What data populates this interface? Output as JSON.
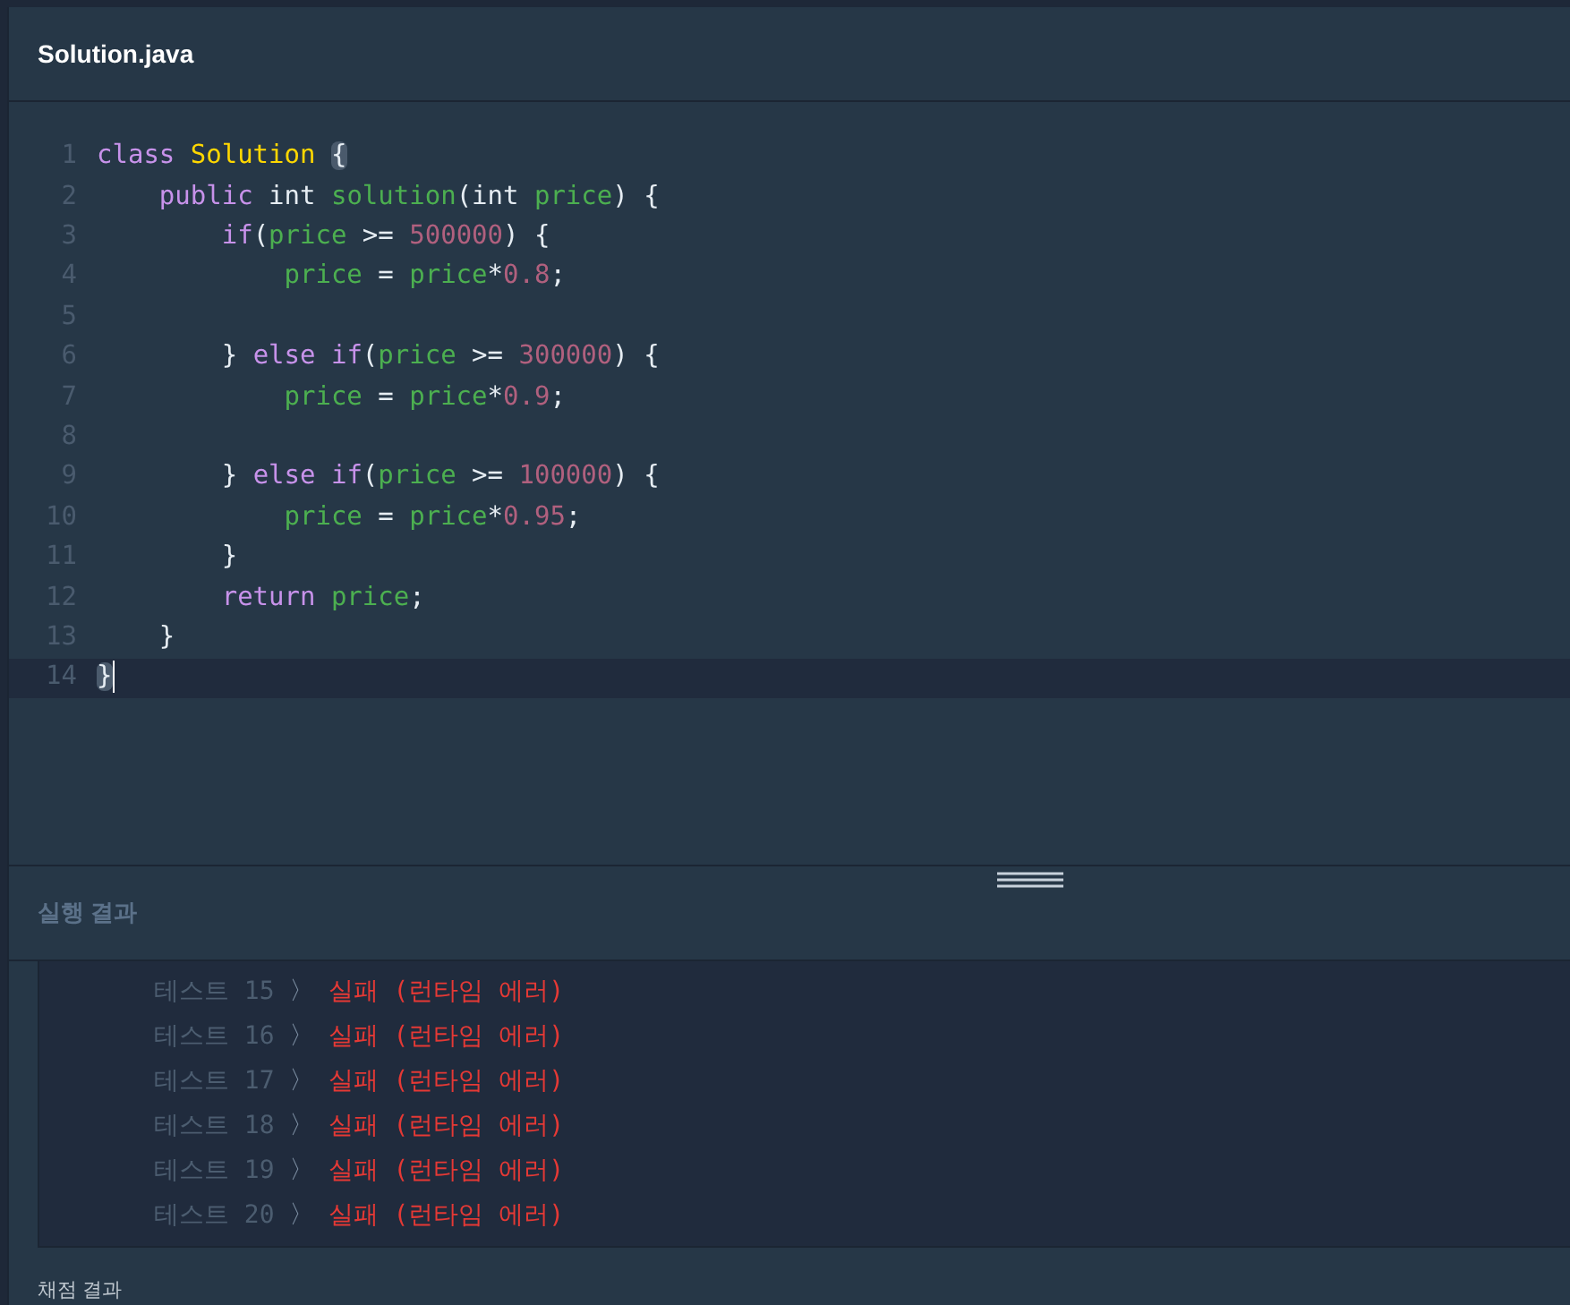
{
  "editor": {
    "filename": "Solution.java",
    "lines": [
      {
        "number": "1",
        "current": false,
        "tokens": [
          {
            "kind": "keyword",
            "text": "class"
          },
          {
            "kind": "type",
            "text": " Solution "
          },
          {
            "kind": "bracket",
            "text": "{"
          }
        ]
      },
      {
        "number": "2",
        "current": false,
        "tokens": [
          {
            "kind": "keyword",
            "text": "    public"
          },
          {
            "kind": "plain",
            "text": " int "
          },
          {
            "kind": "name",
            "text": "solution"
          },
          {
            "kind": "plain",
            "text": "(int "
          },
          {
            "kind": "name",
            "text": "price"
          },
          {
            "kind": "plain",
            "text": ") {"
          }
        ]
      },
      {
        "number": "3",
        "current": false,
        "tokens": [
          {
            "kind": "keyword",
            "text": "        if"
          },
          {
            "kind": "plain",
            "text": "("
          },
          {
            "kind": "name",
            "text": "price"
          },
          {
            "kind": "plain",
            "text": " >= "
          },
          {
            "kind": "number",
            "text": "500000"
          },
          {
            "kind": "plain",
            "text": ") {"
          }
        ]
      },
      {
        "number": "4",
        "current": false,
        "tokens": [
          {
            "kind": "name",
            "text": "            price"
          },
          {
            "kind": "plain",
            "text": " = "
          },
          {
            "kind": "name",
            "text": "price"
          },
          {
            "kind": "plain",
            "text": "*"
          },
          {
            "kind": "number",
            "text": "0.8"
          },
          {
            "kind": "plain",
            "text": ";"
          }
        ]
      },
      {
        "number": "5",
        "current": false
      },
      {
        "number": "6",
        "current": false,
        "tokens": [
          {
            "kind": "plain",
            "text": "        } "
          },
          {
            "kind": "keyword",
            "text": "else if"
          },
          {
            "kind": "plain",
            "text": "("
          },
          {
            "kind": "name",
            "text": "price"
          },
          {
            "kind": "plain",
            "text": " >= "
          },
          {
            "kind": "number",
            "text": "300000"
          },
          {
            "kind": "plain",
            "text": ") {"
          }
        ]
      },
      {
        "number": "7",
        "current": false,
        "tokens": [
          {
            "kind": "name",
            "text": "            price"
          },
          {
            "kind": "plain",
            "text": " = "
          },
          {
            "kind": "name",
            "text": "price"
          },
          {
            "kind": "plain",
            "text": "*"
          },
          {
            "kind": "number",
            "text": "0.9"
          },
          {
            "kind": "plain",
            "text": ";"
          }
        ]
      },
      {
        "number": "8",
        "current": false
      },
      {
        "number": "9",
        "current": false,
        "tokens": [
          {
            "kind": "plain",
            "text": "        } "
          },
          {
            "kind": "keyword",
            "text": "else if"
          },
          {
            "kind": "plain",
            "text": "("
          },
          {
            "kind": "name",
            "text": "price"
          },
          {
            "kind": "plain",
            "text": " >= "
          },
          {
            "kind": "number",
            "text": "100000"
          },
          {
            "kind": "plain",
            "text": ") {"
          }
        ]
      },
      {
        "number": "10",
        "current": false,
        "tokens": [
          {
            "kind": "name",
            "text": "            price"
          },
          {
            "kind": "plain",
            "text": " = "
          },
          {
            "kind": "name",
            "text": "price"
          },
          {
            "kind": "plain",
            "text": "*"
          },
          {
            "kind": "number",
            "text": "0.95"
          },
          {
            "kind": "plain",
            "text": ";"
          }
        ]
      },
      {
        "number": "11",
        "current": false,
        "tokens": [
          {
            "kind": "plain",
            "text": "        }"
          }
        ]
      },
      {
        "number": "12",
        "current": false,
        "tokens": [
          {
            "kind": "keyword",
            "text": "        return"
          },
          {
            "kind": "name",
            "text": " price"
          },
          {
            "kind": "plain",
            "text": ";"
          }
        ]
      },
      {
        "number": "13",
        "current": false,
        "tokens": [
          {
            "kind": "plain",
            "text": "    }"
          }
        ]
      },
      {
        "number": "14",
        "current": true,
        "tokens": [
          {
            "kind": "bracket",
            "text": "}"
          }
        ]
      }
    ]
  },
  "results": {
    "title": "실행 결과",
    "rows": [
      {
        "label": "테스트 15",
        "separator": "〉",
        "result": "실패 (런타임 에러)"
      },
      {
        "label": "테스트 16",
        "separator": "〉",
        "result": "실패 (런타임 에러)"
      },
      {
        "label": "테스트 17",
        "separator": "〉",
        "result": "실패 (런타임 에러)"
      },
      {
        "label": "테스트 18",
        "separator": "〉",
        "result": "실패 (런타임 에러)"
      },
      {
        "label": "테스트 19",
        "separator": "〉",
        "result": "실패 (런타임 에러)"
      },
      {
        "label": "테스트 20",
        "separator": "〉",
        "result": "실패 (런타임 에러)"
      }
    ]
  },
  "grading": {
    "title": "채점 결과"
  }
}
